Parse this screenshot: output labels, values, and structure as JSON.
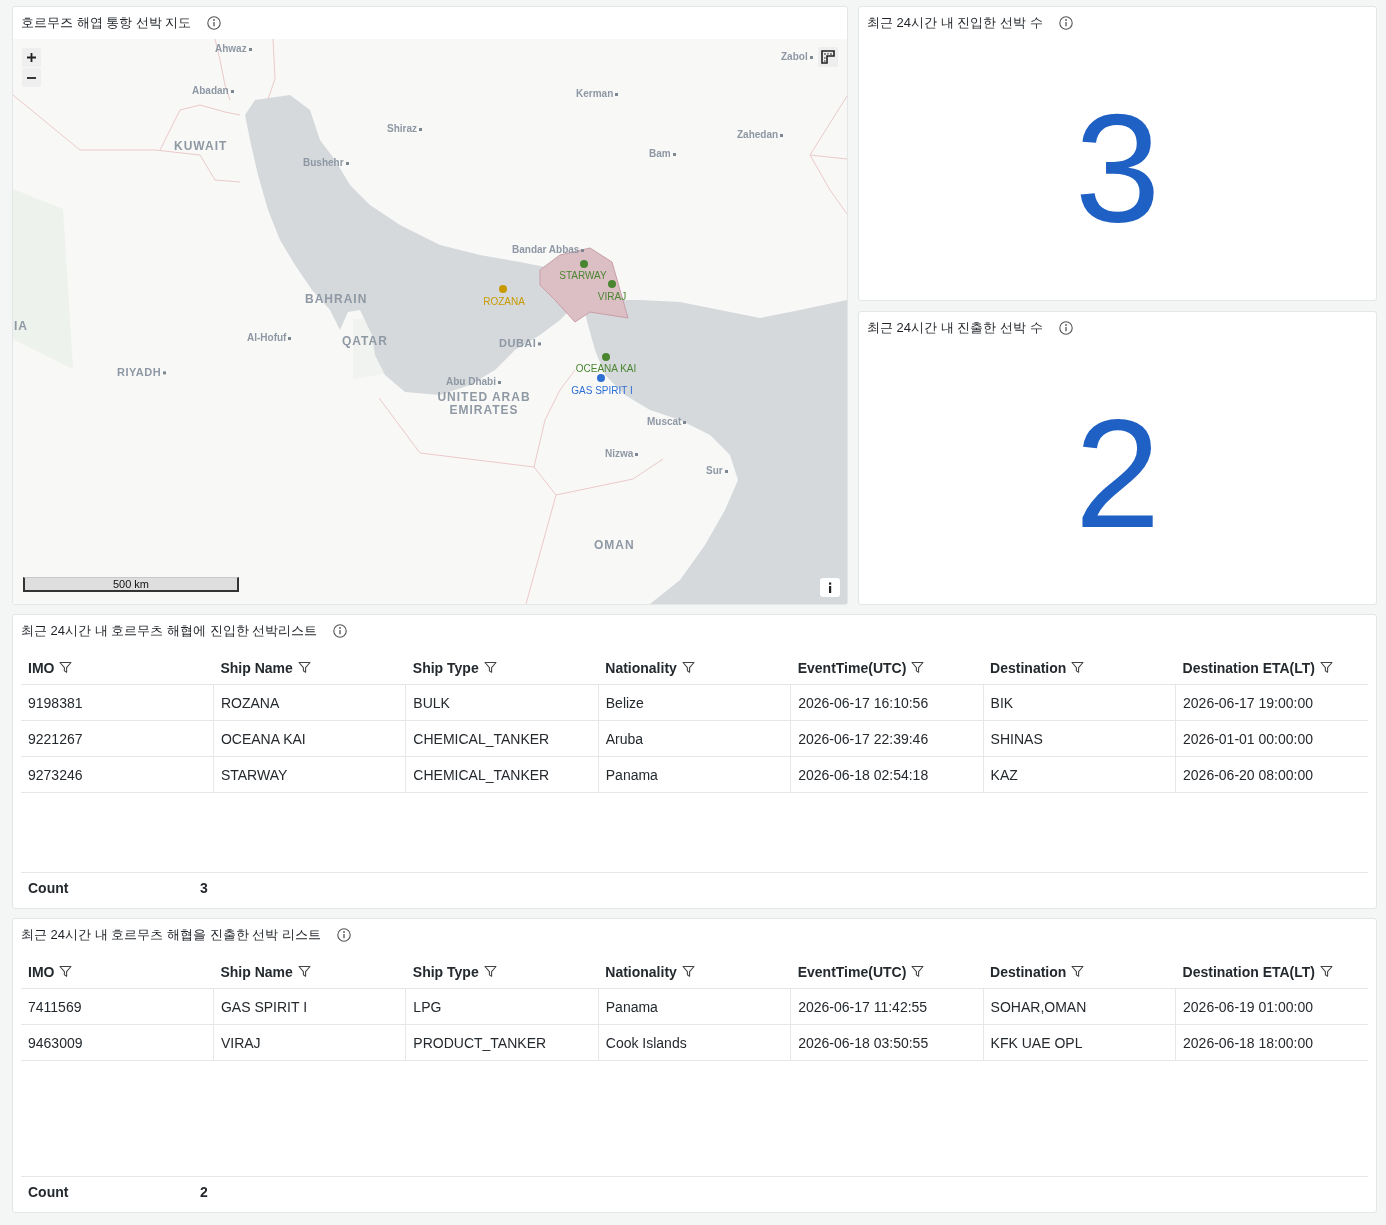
{
  "map_panel": {
    "title": "호르무즈 해엽 통항 선박 지도",
    "labels": [
      {
        "text": "Ahwaz",
        "kind": "city"
      },
      {
        "text": "Zabol",
        "kind": "city"
      },
      {
        "text": "Abadan",
        "kind": "city"
      },
      {
        "text": "Kerman",
        "kind": "city"
      },
      {
        "text": "Shiraz",
        "kind": "city"
      },
      {
        "text": "Zahedan",
        "kind": "city"
      },
      {
        "text": "KUWAIT",
        "kind": "country"
      },
      {
        "text": "Bam",
        "kind": "city"
      },
      {
        "text": "Bushehr",
        "kind": "city"
      },
      {
        "text": "Bandar Abbas",
        "kind": "city"
      },
      {
        "text": "BAHRAIN",
        "kind": "country"
      },
      {
        "text": "IA",
        "kind": "country"
      },
      {
        "text": "Al-Hofuf",
        "kind": "city"
      },
      {
        "text": "QATAR",
        "kind": "country"
      },
      {
        "text": "DUBAI",
        "kind": "capital"
      },
      {
        "text": "RIYADH",
        "kind": "capital"
      },
      {
        "text": "Abu Dhabi",
        "kind": "city"
      },
      {
        "text": "UNITED ARAB EMIRATES",
        "kind": "country"
      },
      {
        "text": "Muscat",
        "kind": "city"
      },
      {
        "text": "Nizwa",
        "kind": "city"
      },
      {
        "text": "Sur",
        "kind": "city"
      },
      {
        "text": "OMAN",
        "kind": "country"
      }
    ],
    "markers": [
      {
        "label": "STARWAY",
        "color": "#4a8530"
      },
      {
        "label": "VIRAJ",
        "color": "#4a8530"
      },
      {
        "label": "ROZANA",
        "color": "#c99a00"
      },
      {
        "label": "OCEANA KAI",
        "color": "#4a8530"
      },
      {
        "label": "GAS SPIRIT I",
        "color": "#2f6fd3"
      }
    ],
    "scale": "500 km"
  },
  "stats": [
    {
      "title": "최근 24시간 내 진입한 선박 수",
      "value": "3"
    },
    {
      "title": "최근 24시간 내 진출한 선박 수",
      "value": "2"
    }
  ],
  "tables": [
    {
      "title": "최근 24시간 내 호르무츠 해협에 진입한 선박리스트",
      "columns": [
        "IMO",
        "Ship Name",
        "Ship Type",
        "Nationality",
        "EventTime(UTC)",
        "Destination",
        "Destination ETA(LT)"
      ],
      "rows": [
        [
          "9198381",
          "ROZANA",
          "BULK",
          "Belize",
          "2026-06-17 16:10:56",
          "BIK",
          "2026-06-17 19:00:00"
        ],
        [
          "9221267",
          "OCEANA KAI",
          "CHEMICAL_TANKER",
          "Aruba",
          "2026-06-17 22:39:46",
          "SHINAS",
          "2026-01-01 00:00:00"
        ],
        [
          "9273246",
          "STARWAY",
          "CHEMICAL_TANKER",
          "Panama",
          "2026-06-18 02:54:18",
          "KAZ",
          "2026-06-20 08:00:00"
        ]
      ],
      "footer": {
        "label": "Count",
        "value": "3"
      }
    },
    {
      "title": "최근 24시간 내 호르무츠 해협을 진출한 선박 리스트",
      "columns": [
        "IMO",
        "Ship Name",
        "Ship Type",
        "Nationality",
        "EventTime(UTC)",
        "Destination",
        "Destination ETA(LT)"
      ],
      "rows": [
        [
          "7411569",
          "GAS SPIRIT I",
          "LPG",
          "Panama",
          "2026-06-17 11:42:55",
          "SOHAR,OMAN",
          "2026-06-19 01:00:00"
        ],
        [
          "9463009",
          "VIRAJ",
          "PRODUCT_TANKER",
          "Cook Islands",
          "2026-06-18 03:50:55",
          "KFK UAE OPL",
          "2026-06-18 18:00:00"
        ]
      ],
      "footer": {
        "label": "Count",
        "value": "2"
      }
    }
  ]
}
